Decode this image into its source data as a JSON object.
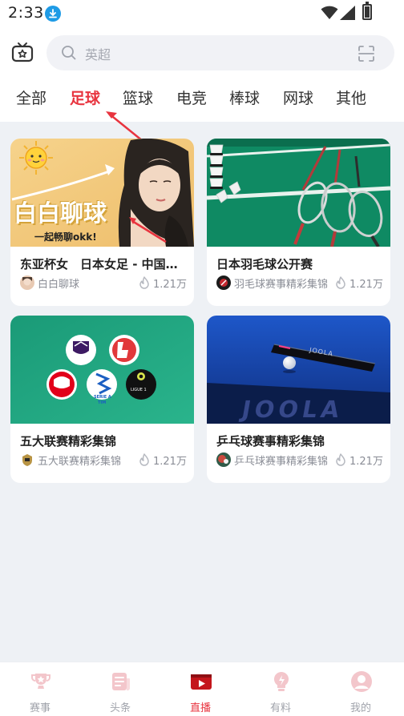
{
  "status_bar": {
    "time": "2:33"
  },
  "search": {
    "placeholder": "英超"
  },
  "tabs": [
    {
      "label": "全部",
      "active": false
    },
    {
      "label": "足球",
      "active": true
    },
    {
      "label": "篮球",
      "active": false
    },
    {
      "label": "电竞",
      "active": false
    },
    {
      "label": "棒球",
      "active": false
    },
    {
      "label": "网球",
      "active": false
    },
    {
      "label": "其他",
      "active": false
    }
  ],
  "cards": [
    {
      "title": "东亚杯女　日本女足 - 中国女足",
      "author": "白白聊球",
      "views": "1.21万",
      "thumb_text": {
        "main": "白白聊球",
        "sub": "一起畅聊okk!"
      }
    },
    {
      "title": "日本羽毛球公开赛",
      "author": "羽毛球赛事精彩集锦",
      "views": "1.21万"
    },
    {
      "title": "五大联赛精彩集锦",
      "author": "五大联赛精彩集锦",
      "views": "1.21万",
      "thumb_text": {
        "logo_serie_a": "SERIE A",
        "logo_tim": "TIM",
        "logo_ligue": "LIGUE 1"
      }
    },
    {
      "title": "乒乓球赛事精彩集锦",
      "author": "乒乓球赛事精彩集锦",
      "views": "1.21万",
      "thumb_text": {
        "brand": "JOOLA",
        "brand_small": "JOOLA"
      }
    }
  ],
  "bottom_nav": [
    {
      "label": "赛事",
      "icon": "trophy-icon",
      "active": false
    },
    {
      "label": "头条",
      "icon": "news-icon",
      "active": false
    },
    {
      "label": "直播",
      "icon": "live-play-icon",
      "active": true
    },
    {
      "label": "有料",
      "icon": "insight-bulb-icon",
      "active": false
    },
    {
      "label": "我的",
      "icon": "profile-icon",
      "active": false
    }
  ],
  "colors": {
    "accent": "#e8343f",
    "page_bg": "#eef1f5",
    "nav_inactive": "#a0a3ab"
  }
}
